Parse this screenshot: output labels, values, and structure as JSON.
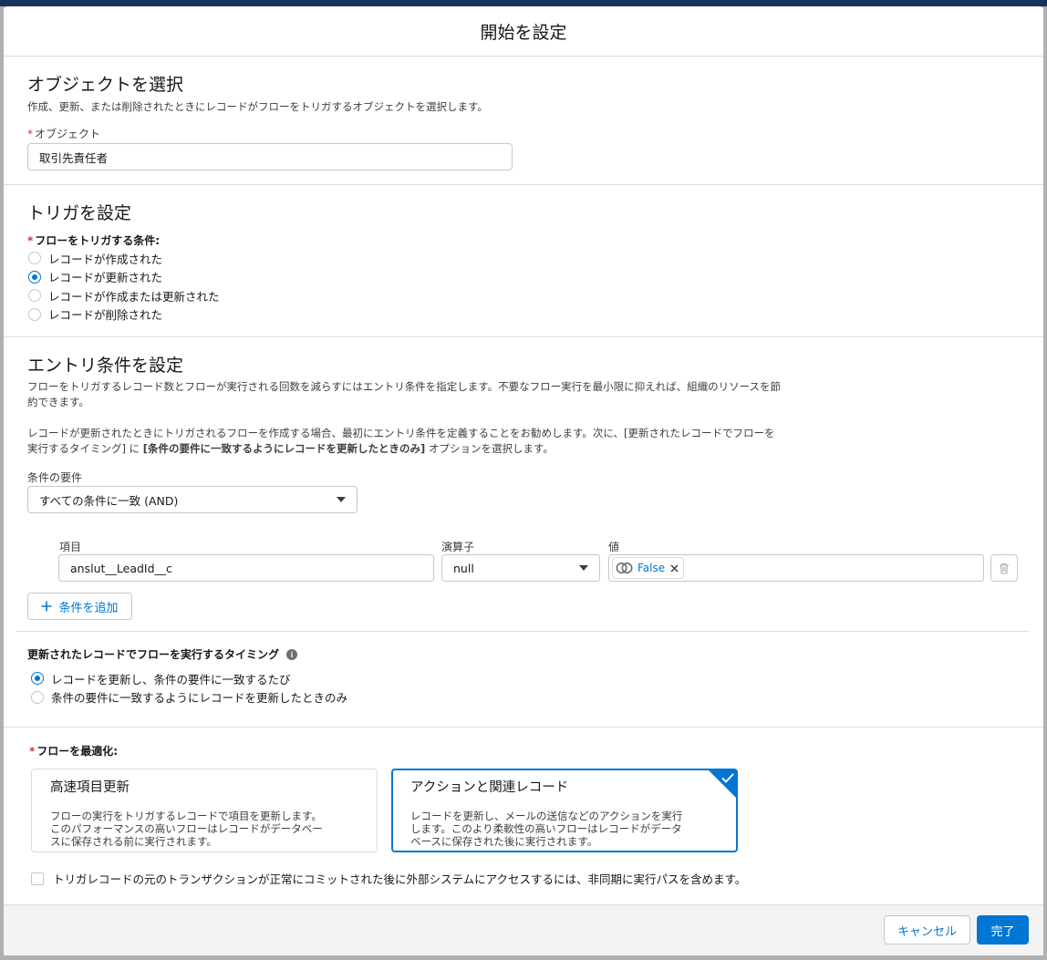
{
  "modal": {
    "title": "開始を設定"
  },
  "object_section": {
    "title": "オブジェクトを選択",
    "description": "作成、更新、または削除されたときにレコードがフローをトリガするオブジェクトを選択します。",
    "required_marker": "*",
    "field_label": "オブジェクト",
    "field_value": "取引先責任者"
  },
  "trigger_section": {
    "title": "トリガを設定",
    "required_marker": "*",
    "label": "フローをトリガする条件:",
    "options": [
      {
        "label": "レコードが作成された",
        "checked": false
      },
      {
        "label": "レコードが更新された",
        "checked": true
      },
      {
        "label": "レコードが作成または更新された",
        "checked": false
      },
      {
        "label": "レコードが削除された",
        "checked": false
      }
    ]
  },
  "entry_section": {
    "title": "エントリ条件を設定",
    "desc1_line1": "フローをトリガするレコード数とフローが実行される回数を減らすにはエントリ条件を指定します。不要なフロー実行を最小限に抑えれば、組織のリソースを節",
    "desc1_line2": "約できます。",
    "desc2_line1": "レコードが更新されたときにトリガされるフローを作成する場合、最初にエントリ条件を定義することをお勧めします。次に、[更新されたレコードでフローを",
    "desc2_line2_a": "実行するタイミング] に ",
    "desc2_line2_bold": "[条件の要件に一致するようにレコードを更新したときのみ]",
    "desc2_line2_b": " オプションを選択します。",
    "requirement_label": "条件の要件",
    "requirement_value": "すべての条件に一致 (AND)",
    "condition": {
      "field_label": "項目",
      "field_value": "anslut__LeadId__c",
      "operator_label": "演算子",
      "operator_value": "null",
      "value_label": "値",
      "value_pill": "False"
    },
    "add_condition_label": "条件を追加"
  },
  "timing_section": {
    "label": "更新されたレコードでフローを実行するタイミング",
    "options": [
      {
        "label": "レコードを更新し、条件の要件に一致するたび",
        "checked": true
      },
      {
        "label": "条件の要件に一致するようにレコードを更新したときのみ",
        "checked": false
      }
    ]
  },
  "optimize_section": {
    "required_marker": "*",
    "label": "フローを最適化:",
    "cards": [
      {
        "title": "高速項目更新",
        "desc": [
          "フローの実行をトリガするレコードで項目を更新します。",
          "このパフォーマンスの高いフローはレコードがデータベー",
          "スに保存される前に実行されます。"
        ],
        "selected": false
      },
      {
        "title": "アクションと関連レコード",
        "desc": [
          "レコードを更新し、メールの送信などのアクションを実行",
          "します。このより柔軟性の高いフローはレコードがデータ",
          "ベースに保存された後に実行されます。"
        ],
        "selected": true
      }
    ],
    "async_checkbox_label": "トリガレコードの元のトランザクションが正常にコミットされた後に外部システムにアクセスするには、非同期に実行パスを含めます。"
  },
  "footer": {
    "cancel_label": "キャンセル",
    "done_label": "完了"
  },
  "colors": {
    "brand": "#0176d3",
    "required": "#c23934",
    "border": "#dddbda"
  }
}
